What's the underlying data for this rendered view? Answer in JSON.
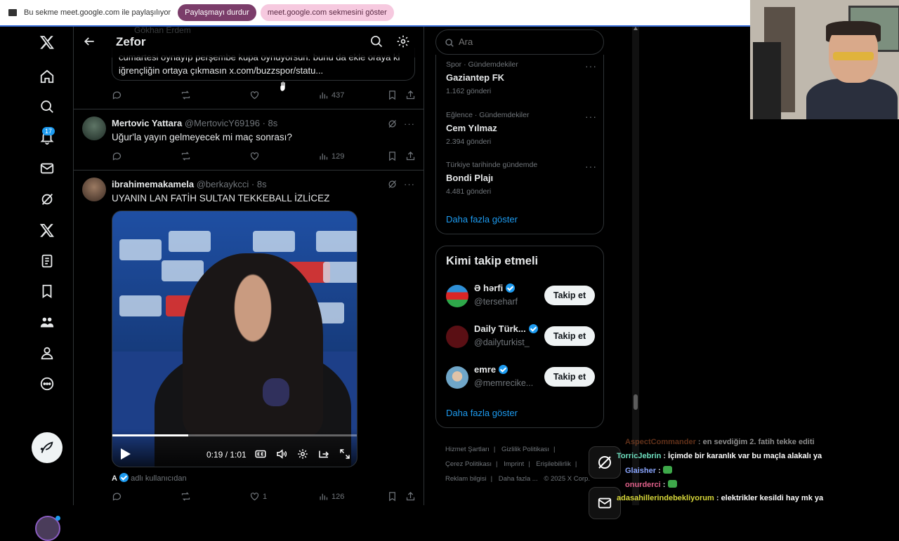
{
  "share_bar": {
    "message": "Bu sekme meet.google.com ile paylaşılıyor",
    "stop_label": "Paylaşmayı durdur",
    "show_label": "meet.google.com sekmesini göster"
  },
  "nav": {
    "notification_count": "17"
  },
  "header": {
    "title": "Zefor"
  },
  "tweet1": {
    "faint_author": "Gökhan Erdem",
    "quote_text": "cumartesi oynayıp perşembe kupa oynuyorsun. bunu da ekle oraya ki iğrençliğin ortaya çıkmasın x.com/buzzspor/statu...",
    "views": "437"
  },
  "tweet2": {
    "name": "Mertovic Yattara",
    "handle": "@MertovicY69196 · 8s",
    "text": "Uğur'la yayın gelmeyecek mi maç sonrası?",
    "views": "129"
  },
  "tweet3": {
    "name": "ibrahimemakamela",
    "handle": "@berkaykcci · 8s",
    "text": "UYANIN LAN FATİH SULTAN TEKKEBALL İZLİCEZ",
    "video_time": "0:19 / 1:01",
    "video_progress": 0.31,
    "from_letter": "A",
    "from_text": "adlı kullanıcıdan",
    "likes": "1",
    "views": "126"
  },
  "sidebar": {
    "search_placeholder": "Ara",
    "trends": [
      {
        "category": "Spor · Gündemdekiler",
        "title": "Gaziantep FK",
        "count": "1.162 gönderi"
      },
      {
        "category": "Eğlence · Gündemdekiler",
        "title": "Cem Yılmaz",
        "count": "2.394 gönderi"
      },
      {
        "category": "Türkiye tarihinde gündemde",
        "title": "Bondi Plajı",
        "count": "4.481 gönderi"
      }
    ],
    "trends_show_more": "Daha fazla göster",
    "follow_title": "Kimi takip etmeli",
    "follow": [
      {
        "name": "Ə hərfi",
        "handle": "@terseharf",
        "button": "Takip et"
      },
      {
        "name": "Daily Türk...",
        "handle": "@dailyturkist_",
        "button": "Takip et"
      },
      {
        "name": "emre",
        "handle": "@memrecike...",
        "button": "Takip et"
      }
    ],
    "follow_show_more": "Daha fazla göster",
    "footer": [
      "Hizmet Şartları",
      "Gizlilik Politikası",
      "Çerez Politikası",
      "Imprint",
      "Erişilebilirlik",
      "Reklam bilgisi",
      "Daha fazla ...",
      "© 2025 X Corp."
    ]
  },
  "chat": [
    {
      "user": "AspectCommander",
      "color": "#b0582e",
      "text": "en sevdiğim 2. fatih tekke editi"
    },
    {
      "user": "TorricJebrin",
      "color": "#6fe0c0",
      "text": "İçimde bir karanlık var bu maçla alakalı ya"
    },
    {
      "user": "Glaisher",
      "color": "#8aa6ff",
      "text": ""
    },
    {
      "user": "onurderci",
      "color": "#e0608a",
      "text": ""
    },
    {
      "user": "adasahillerindebekliyorum",
      "color": "#d8d83a",
      "text": "elektrikler kesildi hay mk ya"
    }
  ],
  "colors": {
    "accent": "#1d9bf0",
    "background": "#000000",
    "border": "#2f3336"
  }
}
